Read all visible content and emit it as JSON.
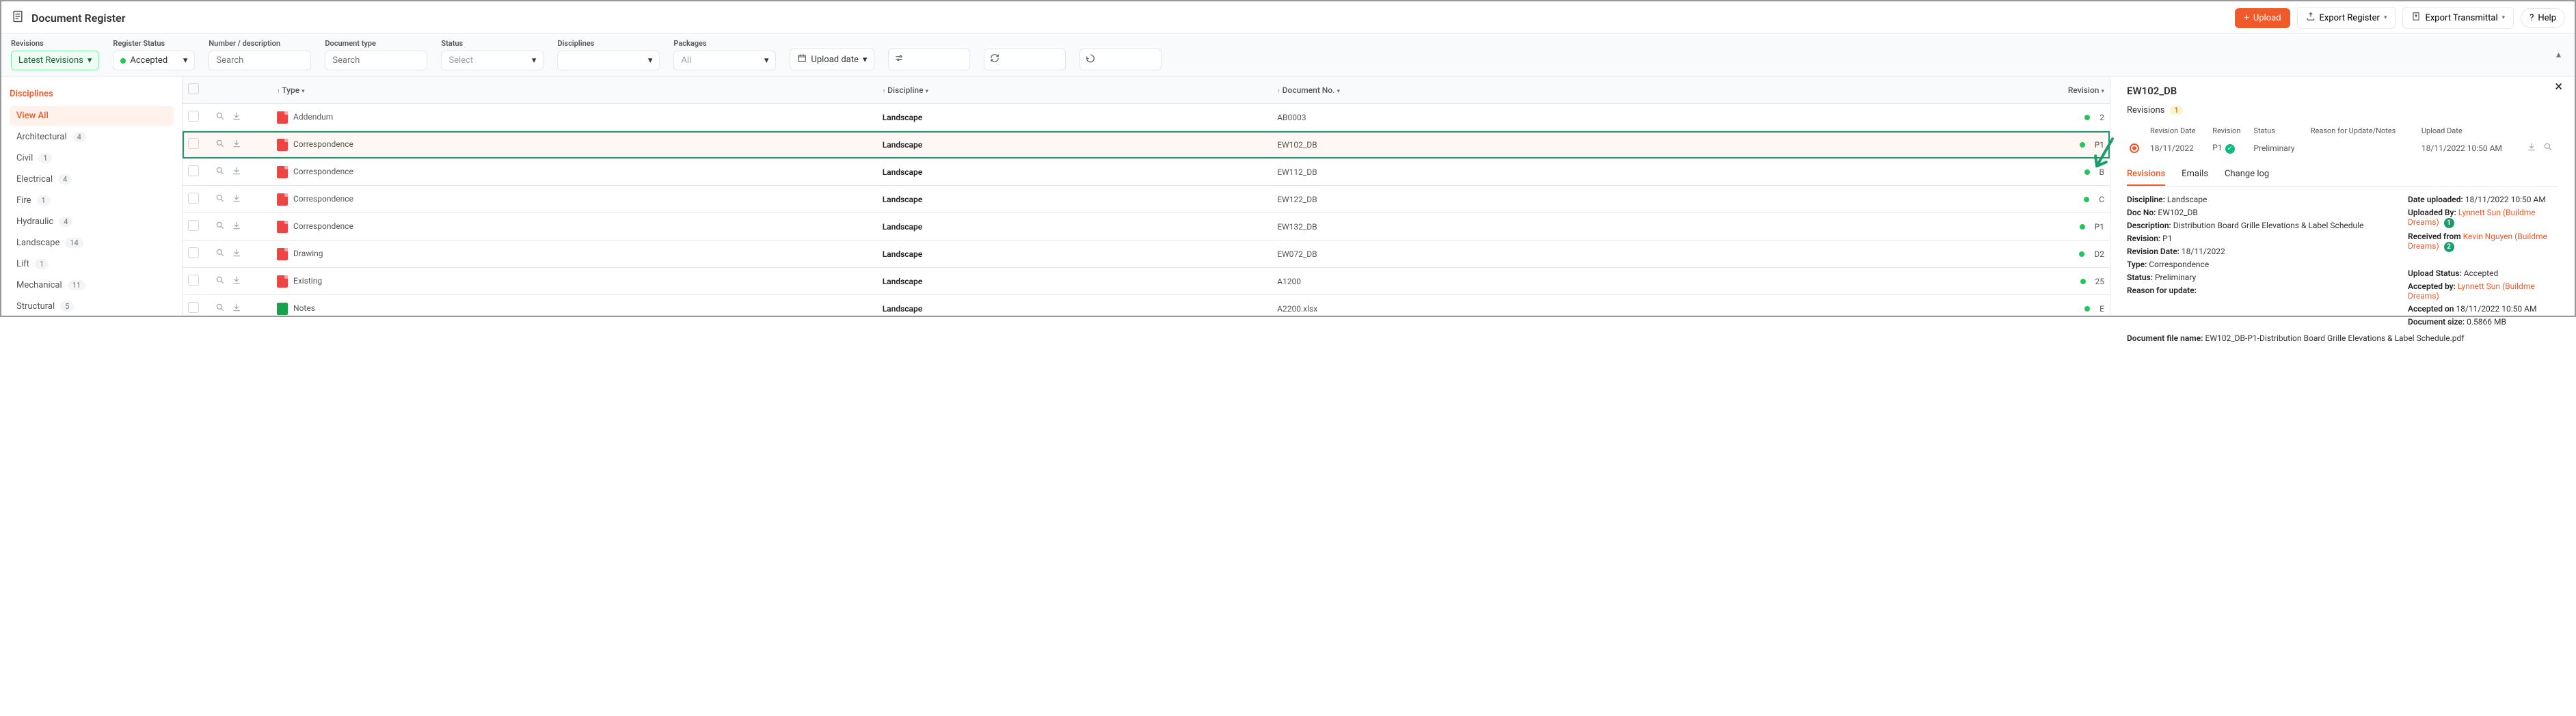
{
  "header": {
    "title": "Document Register",
    "upload": "Upload",
    "export_register": "Export Register",
    "export_transmittal": "Export Transmittal",
    "help": "Help"
  },
  "filters": {
    "revisions_label": "Revisions",
    "revisions_value": "Latest Revisions",
    "register_status_label": "Register Status",
    "register_status_value": "Accepted",
    "number_label": "Number / description",
    "number_ph": "Search",
    "doctype_label": "Document type",
    "doctype_ph": "Search",
    "status_label": "Status",
    "status_ph": "Select",
    "disciplines_label": "Disciplines",
    "packages_label": "Packages",
    "packages_value": "All",
    "upload_date": "Upload date"
  },
  "sidebar": {
    "heading": "Disciplines",
    "items": [
      {
        "label": "View All",
        "count": ""
      },
      {
        "label": "Architectural",
        "count": "4"
      },
      {
        "label": "Civil",
        "count": "1"
      },
      {
        "label": "Electrical",
        "count": "4"
      },
      {
        "label": "Fire",
        "count": "1"
      },
      {
        "label": "Hydraulic",
        "count": "4"
      },
      {
        "label": "Landscape",
        "count": "14"
      },
      {
        "label": "Lift",
        "count": "1"
      },
      {
        "label": "Mechanical",
        "count": "11"
      },
      {
        "label": "Structural",
        "count": "5"
      }
    ]
  },
  "columns": {
    "type": "Type",
    "discipline": "Discipline",
    "docno": "Document No.",
    "revision": "Revision"
  },
  "rows": [
    {
      "type": "Addendum",
      "disc": "Landscape",
      "docno": "AB0003",
      "rev": "2",
      "file": "pdf"
    },
    {
      "type": "Correspondence",
      "disc": "Landscape",
      "docno": "EW102_DB",
      "rev": "P1",
      "file": "pdf",
      "hl": true
    },
    {
      "type": "Correspondence",
      "disc": "Landscape",
      "docno": "EW112_DB",
      "rev": "B",
      "file": "pdf"
    },
    {
      "type": "Correspondence",
      "disc": "Landscape",
      "docno": "EW122_DB",
      "rev": "C",
      "file": "pdf"
    },
    {
      "type": "Correspondence",
      "disc": "Landscape",
      "docno": "EW132_DB",
      "rev": "P1",
      "file": "pdf"
    },
    {
      "type": "Drawing",
      "disc": "Landscape",
      "docno": "EW072_DB",
      "rev": "D2",
      "file": "pdf"
    },
    {
      "type": "Existing",
      "disc": "Landscape",
      "docno": "A1200",
      "rev": "25",
      "file": "pdf"
    },
    {
      "type": "Notes",
      "disc": "Landscape",
      "docno": "A2200.xlsx",
      "rev": "E",
      "file": "xls"
    }
  ],
  "detail": {
    "title": "EW102_DB",
    "revisions_heading": "Revisions",
    "rev_count": "1",
    "rev_cols": {
      "date": "Revision Date",
      "rev": "Revision",
      "status": "Status",
      "reason": "Reason for Update/Notes",
      "upload": "Upload Date"
    },
    "rev_row": {
      "date": "18/11/2022",
      "rev": "P1",
      "status": "Preliminary",
      "upload": "18/11/2022 10:50 AM"
    },
    "tabs": {
      "revisions": "Revisions",
      "emails": "Emails",
      "changelog": "Change log"
    },
    "left": {
      "discipline_l": "Discipline:",
      "discipline_v": "Landscape",
      "docno_l": "Doc No:",
      "docno_v": "EW102_DB",
      "desc_l": "Description:",
      "desc_v": "Distribution Board Grille Elevations & Label Schedule",
      "revision_l": "Revision:",
      "revision_v": "P1",
      "revdate_l": "Revision Date:",
      "revdate_v": "18/11/2022",
      "type_l": "Type:",
      "type_v": "Correspondence",
      "status_l": "Status:",
      "status_v": "Preliminary",
      "reason_l": "Reason for update:"
    },
    "right": {
      "uploaded_l": "Date uploaded:",
      "uploaded_v": "18/11/2022 10:50 AM",
      "by_l": "Uploaded By:",
      "by_v": "Lynnett Sun (Buildme Dreams)",
      "from_l": "Received from",
      "from_v": "Kevin Nguyen (Buildme Dreams)",
      "upstat_l": "Upload Status:",
      "upstat_v": "Accepted",
      "accby_l": "Accepted by:",
      "accby_v": "Lynnett Sun (Buildme Dreams)",
      "accon_l": "Accepted on",
      "accon_v": "18/11/2022 10:50 AM",
      "size_l": "Document size:",
      "size_v": "0.5866 MB"
    },
    "filename_l": "Document file name:",
    "filename_v": "EW102_DB-P1-Distribution Board Grille Elevations & Label Schedule.pdf"
  }
}
